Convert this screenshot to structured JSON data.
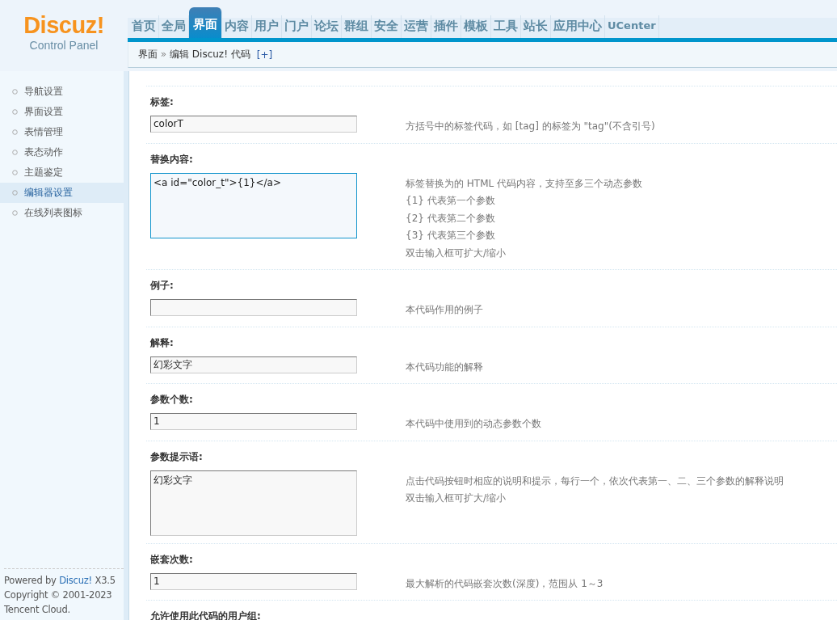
{
  "logo": {
    "name": "Discuz!",
    "subtitle": "Control Panel"
  },
  "nav": [
    {
      "label": "首页",
      "selected": false
    },
    {
      "label": "全局",
      "selected": false
    },
    {
      "label": "界面",
      "selected": true
    },
    {
      "label": "内容",
      "selected": false
    },
    {
      "label": "用户",
      "selected": false
    },
    {
      "label": "门户",
      "selected": false
    },
    {
      "label": "论坛",
      "selected": false
    },
    {
      "label": "群组",
      "selected": false
    },
    {
      "label": "安全",
      "selected": false
    },
    {
      "label": "运营",
      "selected": false
    },
    {
      "label": "插件",
      "selected": false
    },
    {
      "label": "模板",
      "selected": false
    },
    {
      "label": "工具",
      "selected": false
    },
    {
      "label": "站长",
      "selected": false
    },
    {
      "label": "应用中心",
      "selected": false
    },
    {
      "label": "UCenter",
      "selected": false
    }
  ],
  "breadcrumb": {
    "items": [
      "界面",
      "编辑 Discuz! 代码"
    ],
    "separator": "»",
    "add": "[+]"
  },
  "sidebar": {
    "items": [
      {
        "label": "导航设置",
        "selected": false
      },
      {
        "label": "界面设置",
        "selected": false
      },
      {
        "label": "表情管理",
        "selected": false
      },
      {
        "label": "表态动作",
        "selected": false
      },
      {
        "label": "主题鉴定",
        "selected": false
      },
      {
        "label": "编辑器设置",
        "selected": true
      },
      {
        "label": "在线列表图标",
        "selected": false
      }
    ],
    "footer": {
      "prefix": "Powered by",
      "link": "Discuz!",
      "version": "X3.5",
      "lines": [
        "Copyright © 2001-2023",
        "Tencent Cloud."
      ]
    }
  },
  "form": [
    {
      "label": "标签:",
      "kind": "input",
      "value": "colorT",
      "focused": false,
      "tips": [
        "方括号中的标签代码，如 [tag] 的标签为 \"tag\"(不含引号)"
      ]
    },
    {
      "label": "替换内容:",
      "kind": "textarea",
      "value": "<a id=\"color_t\">{1}</a>",
      "focused": true,
      "tips": [
        "标签替换为的 HTML 代码内容，支持至多三个动态参数",
        "{1} 代表第一个参数",
        "{2} 代表第二个参数",
        "{3} 代表第三个参数",
        "双击输入框可扩大/缩小"
      ]
    },
    {
      "label": "例子:",
      "kind": "input",
      "focused": false,
      "tips": [
        "本代码作用的例子"
      ]
    },
    {
      "label": "解释:",
      "kind": "input",
      "value": "幻彩文字",
      "focused": false,
      "tips": [
        "本代码功能的解释"
      ]
    },
    {
      "label": "参数个数:",
      "kind": "input",
      "value": "1",
      "focused": false,
      "tips": [
        "本代码中使用到的动态参数个数"
      ]
    },
    {
      "label": "参数提示语:",
      "kind": "textarea",
      "value": "幻彩文字",
      "focused": false,
      "tips": [
        "点击代码按钮时相应的说明和提示，每行一个，依次代表第一、二、三个参数的解释说明",
        "双击输入框可扩大/缩小"
      ]
    },
    {
      "label": "嵌套次数:",
      "kind": "input",
      "value": "1",
      "focused": false,
      "tips": [
        "最大解析的代码嵌套次数(深度)，范围从 1～3"
      ]
    },
    {
      "label": "允许使用此代码的用户组:",
      "kind": "heading"
    }
  ]
}
